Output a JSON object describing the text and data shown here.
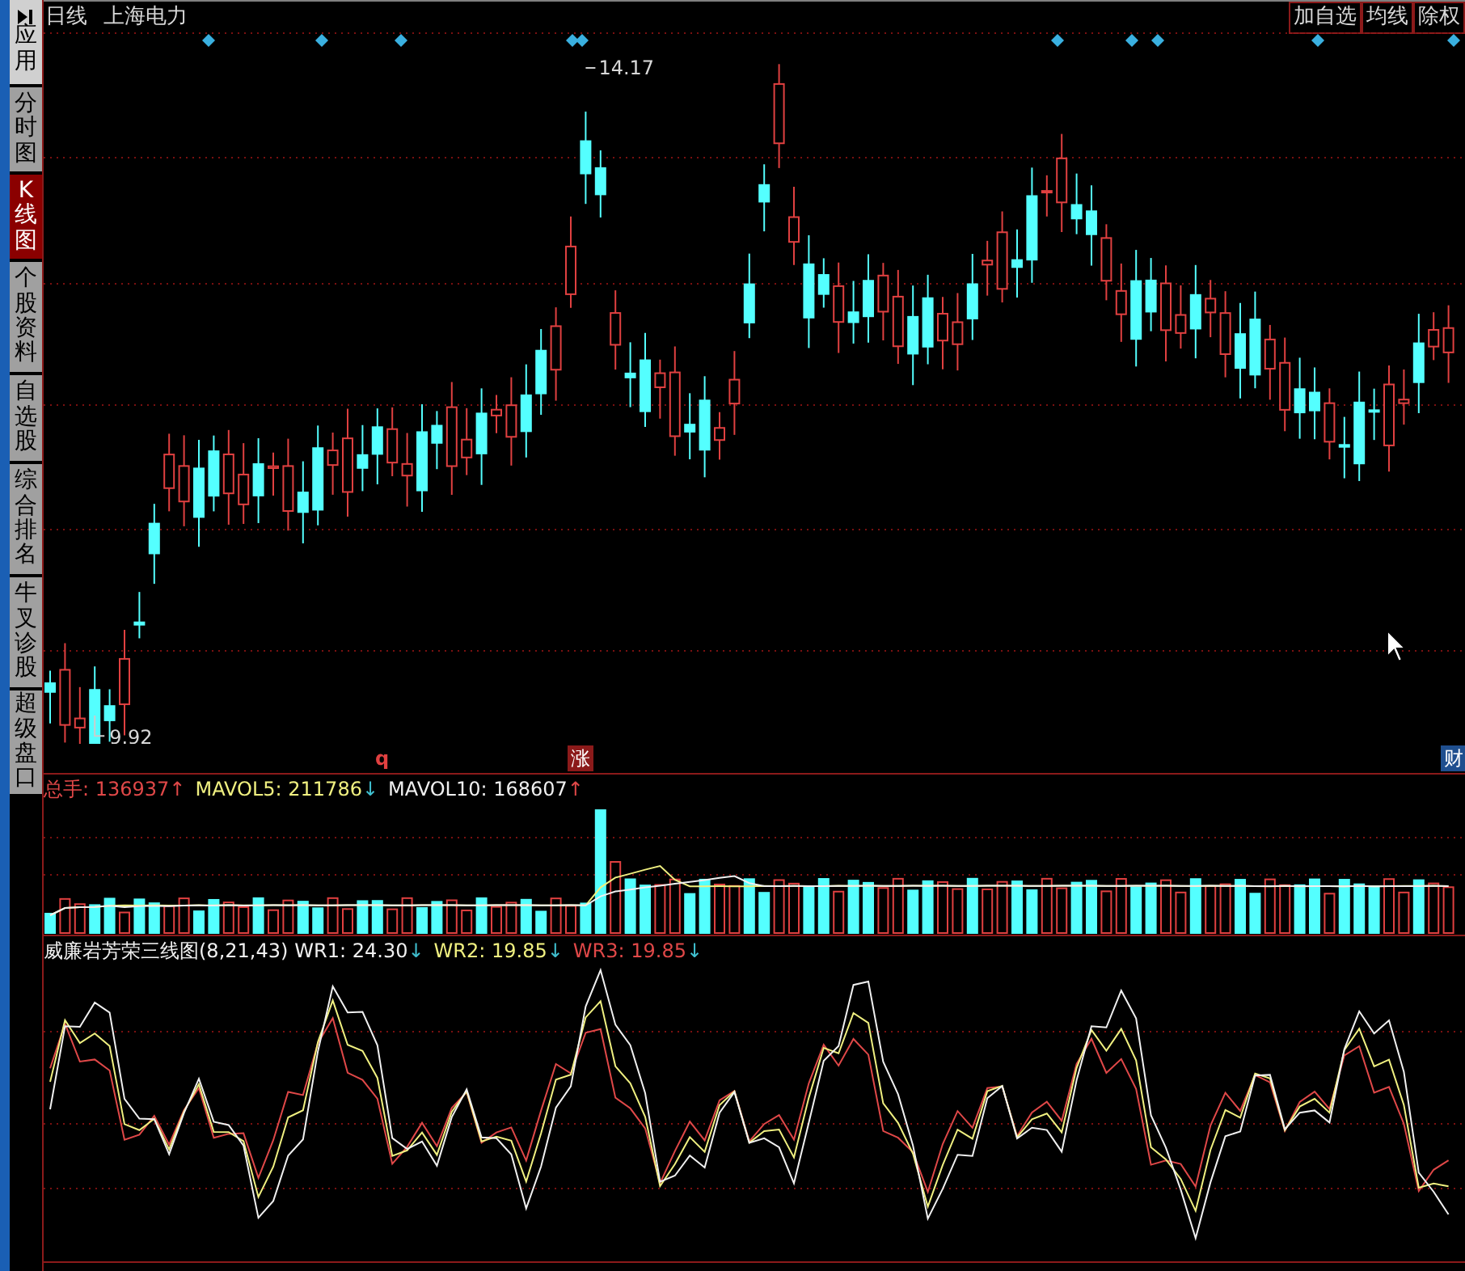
{
  "sidebar": {
    "items": [
      {
        "label": "应用",
        "kind": "apps",
        "selected": false
      },
      {
        "label": "分时图",
        "kind": "tab",
        "selected": false
      },
      {
        "label": "K线图",
        "kind": "tab",
        "selected": true
      },
      {
        "label": "个股资料",
        "kind": "tab",
        "selected": false
      },
      {
        "label": "自选股",
        "kind": "tab",
        "selected": false
      },
      {
        "label": "综合排名",
        "kind": "tab",
        "selected": false
      },
      {
        "label": "牛叉诊股",
        "kind": "tab",
        "selected": false
      },
      {
        "label": "超级盘口",
        "kind": "tab",
        "selected": false
      }
    ]
  },
  "header": {
    "period": "日线",
    "stock_name": "上海电力",
    "buttons": [
      "加自选",
      "均线",
      "除权"
    ]
  },
  "price_chart": {
    "high_label": "14.17",
    "low_label": "9.92"
  },
  "event_markers": [
    {
      "text": "q",
      "kind": "plain"
    },
    {
      "text": "涨",
      "kind": "boxed",
      "color": "#8b1a1a"
    },
    {
      "text": "财",
      "kind": "boxed",
      "color": "#1f4f8f"
    }
  ],
  "volume_legend": [
    {
      "name": "总手: ",
      "value": "136937",
      "arrow": "↑",
      "color": "#e04848"
    },
    {
      "name": "MAVOL5: ",
      "value": "211786",
      "arrow": "↓",
      "color": "#f0f080"
    },
    {
      "name": "MAVOL10: ",
      "value": "168607",
      "arrow": "↑",
      "color": "#f0f0f0"
    }
  ],
  "indicator_legend": {
    "title": "威廉岩芳荣三线图(8,21,43)",
    "items": [
      {
        "name": "WR1: ",
        "value": "24.30",
        "arrow": "↓",
        "color": "#f0f0f0"
      },
      {
        "name": "WR2: ",
        "value": "19.85",
        "arrow": "↓",
        "color": "#f0f080"
      },
      {
        "name": "WR3: ",
        "value": "19.85",
        "arrow": "↓",
        "color": "#e04848"
      }
    ]
  }
}
